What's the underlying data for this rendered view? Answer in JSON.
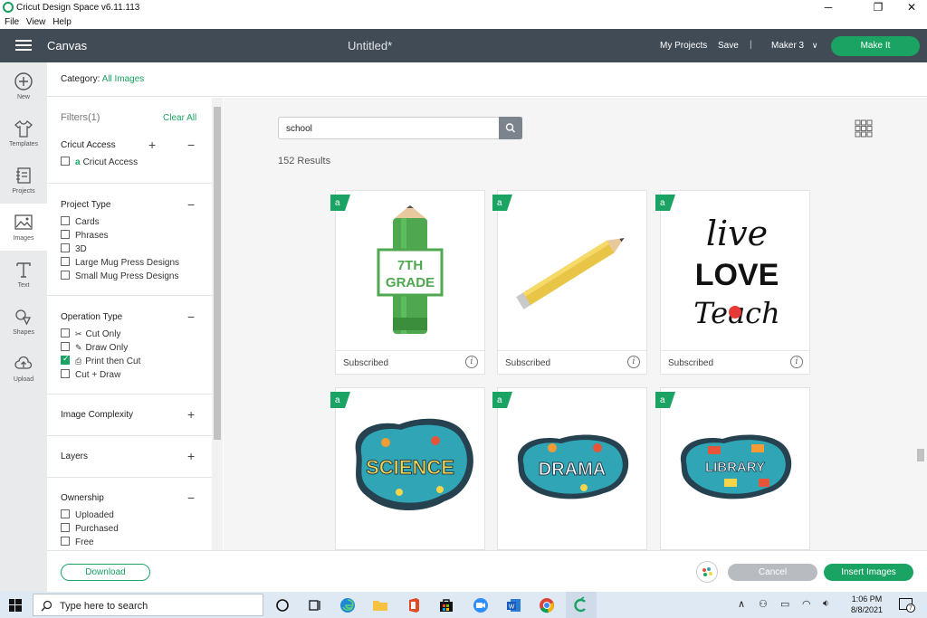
{
  "app": {
    "window_title": "Cricut Design Space  v6.11.113",
    "menu": [
      "File",
      "View",
      "Help"
    ]
  },
  "header": {
    "canvas_label": "Canvas",
    "doc_title": "Untitled*",
    "my_projects": "My Projects",
    "save": "Save",
    "separator": "|",
    "machine": "Maker 3",
    "make_it": "Make It"
  },
  "leftbar": {
    "items": [
      {
        "label": "New",
        "icon": "plus-circle-icon"
      },
      {
        "label": "Templates",
        "icon": "shirt-icon"
      },
      {
        "label": "Projects",
        "icon": "notebook-icon"
      },
      {
        "label": "Images",
        "icon": "image-icon"
      },
      {
        "label": "Text",
        "icon": "text-t-icon"
      },
      {
        "label": "Shapes",
        "icon": "shapes-icon"
      },
      {
        "label": "Upload",
        "icon": "upload-cloud-icon"
      }
    ],
    "active": "Images"
  },
  "category": {
    "prefix": "Category:",
    "value": "All Images"
  },
  "filters": {
    "title": "Filters(1)",
    "clear_all": "Clear All",
    "cricut_access": {
      "title": "Cricut Access",
      "options": [
        {
          "label": "Cricut Access",
          "checked": false
        }
      ]
    },
    "project_type": {
      "title": "Project Type",
      "options": [
        {
          "label": "Cards",
          "checked": false
        },
        {
          "label": "Phrases",
          "checked": false
        },
        {
          "label": "3D",
          "checked": false
        },
        {
          "label": "Large Mug Press Designs",
          "checked": false
        },
        {
          "label": "Small Mug Press Designs",
          "checked": false
        }
      ]
    },
    "operation_type": {
      "title": "Operation Type",
      "options": [
        {
          "label": "Cut Only",
          "checked": false
        },
        {
          "label": "Draw Only",
          "checked": false
        },
        {
          "label": "Print then Cut",
          "checked": true
        },
        {
          "label": "Cut + Draw",
          "checked": false
        }
      ]
    },
    "image_complexity": {
      "title": "Image Complexity"
    },
    "layers": {
      "title": "Layers"
    },
    "ownership": {
      "title": "Ownership",
      "options": [
        {
          "label": "Uploaded",
          "checked": false
        },
        {
          "label": "Purchased",
          "checked": false
        },
        {
          "label": "Free",
          "checked": false
        }
      ]
    }
  },
  "search": {
    "query": "school",
    "results": "152 Results"
  },
  "cards": [
    {
      "art_text_1": "7TH",
      "art_text_2": "GRADE",
      "status": "Subscribed"
    },
    {
      "status": "Subscribed"
    },
    {
      "art_text_1": "live",
      "art_text_2": "LOVE",
      "art_text_3": "Teach",
      "status": "Subscribed"
    },
    {
      "art_text_1": "SCIENCE"
    },
    {
      "art_text_1": "DRAMA"
    },
    {
      "art_text_1": "LIBRARY"
    }
  ],
  "bottom": {
    "download": "Download",
    "cancel": "Cancel",
    "insert": "Insert Images"
  },
  "taskbar": {
    "search_placeholder": "Type here to search",
    "time": "1:06 PM",
    "date": "8/8/2021",
    "notifications": "7"
  },
  "colors": {
    "brand_green": "#1aa363",
    "header": "#414b56"
  }
}
